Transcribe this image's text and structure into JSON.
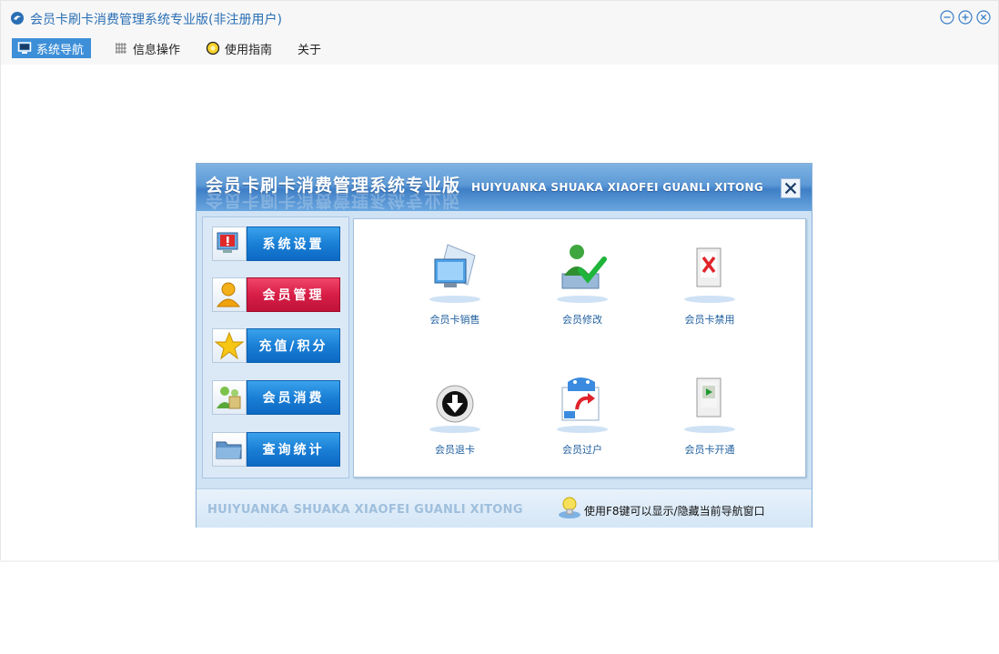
{
  "window": {
    "title": "会员卡刷卡消费管理系统专业版(非注册用户)"
  },
  "menu": [
    {
      "label": "系统导航",
      "icon": "monitor-icon",
      "active": true
    },
    {
      "label": "信息操作",
      "icon": "grid-icon",
      "active": false
    },
    {
      "label": "使用指南",
      "icon": "help-circle-icon",
      "active": false
    },
    {
      "label": "关于",
      "icon": "",
      "active": false
    }
  ],
  "nav": {
    "title_cn": "会员卡刷卡消费管理系统专业版",
    "title_en": "HUIYUANKA SHUAKA XIAOFEI GUANLI XITONG",
    "sidebar": [
      {
        "label": "系统设置",
        "icon": "settings-monitor-icon",
        "active": false
      },
      {
        "label": "会员管理",
        "icon": "user-icon",
        "active": true
      },
      {
        "label": "充值/积分",
        "icon": "star-icon",
        "active": false
      },
      {
        "label": "会员消费",
        "icon": "shopping-users-icon",
        "active": false
      },
      {
        "label": "查询统计",
        "icon": "folder-icon",
        "active": false
      }
    ],
    "tiles": [
      {
        "label": "会员卡销售",
        "icon": "card-sale-icon"
      },
      {
        "label": "会员修改",
        "icon": "member-edit-icon"
      },
      {
        "label": "会员卡禁用",
        "icon": "card-disable-icon"
      },
      {
        "label": "会员退卡",
        "icon": "card-return-icon"
      },
      {
        "label": "会员过户",
        "icon": "member-transfer-icon"
      },
      {
        "label": "会员卡开通",
        "icon": "card-activate-icon"
      }
    ],
    "footer": {
      "en": "HUIYUANKA SHUAKA XIAOFEI GUANLI XITONG",
      "tip": "使用F8键可以显示/隐藏当前导航窗口"
    }
  },
  "colors": {
    "title_text": "#2a6fb5",
    "menu_active_bg": "#3d8fd8",
    "side_button_blue": "#1a7fd6",
    "side_button_active_red": "#d81e46",
    "tile_label": "#1f5f9f"
  }
}
